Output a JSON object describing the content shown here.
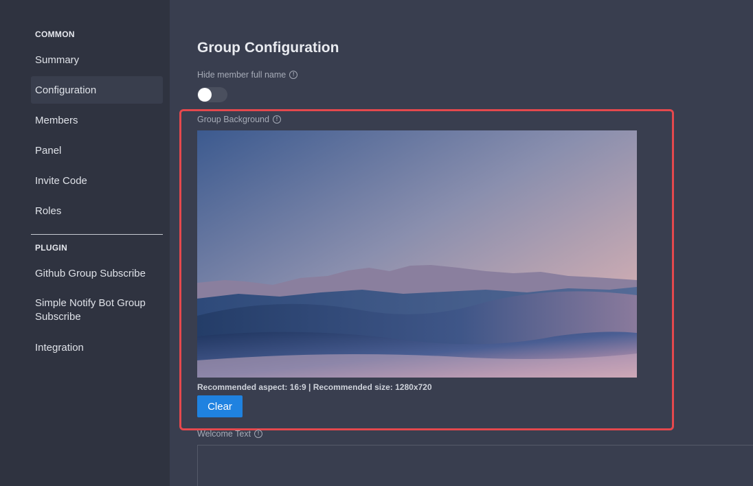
{
  "sidebar": {
    "common_title": "COMMON",
    "common_items": [
      {
        "label": "Summary"
      },
      {
        "label": "Configuration"
      },
      {
        "label": "Members"
      },
      {
        "label": "Panel"
      },
      {
        "label": "Invite Code"
      },
      {
        "label": "Roles"
      }
    ],
    "plugin_title": "PLUGIN",
    "plugin_items": [
      {
        "label": "Github Group Subscribe"
      },
      {
        "label": "Simple Notify Bot Group Subscribe"
      },
      {
        "label": "Integration"
      }
    ]
  },
  "main": {
    "title": "Group Configuration",
    "hide_member_label": "Hide member full name",
    "hide_member_toggle": false,
    "background_label": "Group Background",
    "background_hint": "Recommended aspect: 16:9 | Recommended size: 1280x720",
    "clear_label": "Clear",
    "welcome_label": "Welcome Text",
    "welcome_value": ""
  },
  "icons": {
    "info": "info-circle-icon"
  },
  "colors": {
    "accent": "#1f82e0",
    "highlight": "#e5484d",
    "sidebar_bg": "#2f3340",
    "main_bg": "#393e4f"
  }
}
